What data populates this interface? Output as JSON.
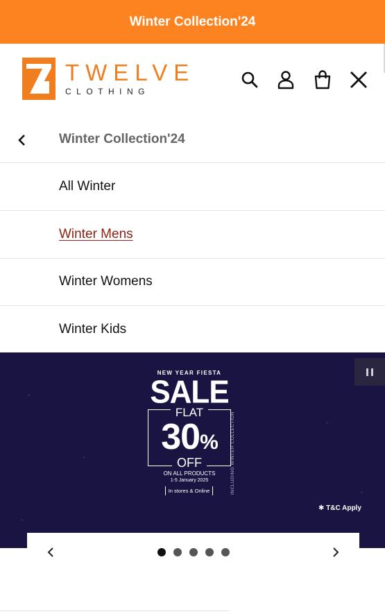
{
  "announcement": {
    "text": "Winter Collection'24"
  },
  "brand": {
    "name": "TWELVE",
    "subtitle": "CLOTHING",
    "accent_color": "#fc8320"
  },
  "header": {
    "icons": [
      "search-icon",
      "account-icon",
      "bag-icon",
      "close-icon"
    ]
  },
  "submenu": {
    "title": "Winter Collection'24",
    "items": [
      {
        "label": "All Winter",
        "active": false
      },
      {
        "label": "Winter Mens",
        "active": true
      },
      {
        "label": "Winter Womens",
        "active": false
      },
      {
        "label": "Winter Kids",
        "active": false
      }
    ]
  },
  "banner": {
    "tagline": "NEW YEAR FIESTA",
    "headline": "SALE",
    "flat": "FLAT",
    "discount_number": "30",
    "discount_symbol": "%",
    "off": "OFF",
    "all_products": "ON ALL PRODUCTS",
    "dates": "1-5 January 2025",
    "stores": "In stores & Online",
    "side_note": "INCLUDING WINTER COLLECTION",
    "terms": "✱ T&C Apply",
    "background_color": "#1a1443"
  },
  "slider": {
    "slide_count": 5,
    "active_index": 0
  }
}
